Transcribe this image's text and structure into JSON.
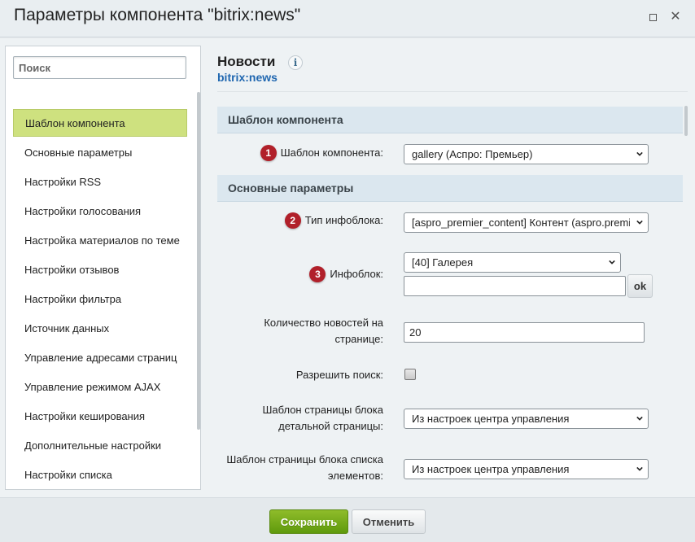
{
  "window": {
    "title": "Параметры компонента \"bitrix:news\"",
    "maximize_icon": "maximize-icon",
    "close_icon": "close-icon",
    "close_glyph": "✕"
  },
  "sidebar": {
    "search_placeholder": "Поиск",
    "items": [
      {
        "label": "Шаблон компонента",
        "active": true
      },
      {
        "label": "Основные параметры"
      },
      {
        "label": "Настройки RSS"
      },
      {
        "label": "Настройки голосования"
      },
      {
        "label": "Настройка материалов по теме"
      },
      {
        "label": "Настройки отзывов"
      },
      {
        "label": "Настройки фильтра"
      },
      {
        "label": "Источник данных"
      },
      {
        "label": "Управление адресами страниц"
      },
      {
        "label": "Управление режимом AJAX"
      },
      {
        "label": "Настройки кеширования"
      },
      {
        "label": "Дополнительные настройки"
      },
      {
        "label": "Настройки списка"
      }
    ]
  },
  "component": {
    "name": "Новости",
    "code": "bitrix:news",
    "info_glyph": "i"
  },
  "sections": {
    "template": "Шаблон компонента",
    "basic": "Основные параметры"
  },
  "fields": {
    "template": {
      "badge": "1",
      "label": "Шаблон компонента:",
      "value": "gallery (Аспро: Премьер)"
    },
    "iblock_type": {
      "badge": "2",
      "label": "Тип инфоблока:",
      "value": "[aspro_premier_content] Контент (aspro.premier)"
    },
    "iblock": {
      "badge": "3",
      "label": "Инфоблок:",
      "value": "[40] Галерея",
      "extra_value": "",
      "ok_label": "ok"
    },
    "news_count": {
      "label_line1": "Количество новостей на",
      "label_line2": "странице:",
      "value": "20"
    },
    "allow_search": {
      "label": "Разрешить поиск:",
      "checked": false
    },
    "detail_template": {
      "label_line1": "Шаблон страницы блока",
      "label_line2": "детальной страницы:",
      "value": "Из настроек центра управления"
    },
    "list_template": {
      "label_line1": "Шаблон страницы блока списка",
      "label_line2": "элементов:",
      "value": "Из настроек центра управления"
    }
  },
  "footer": {
    "save_label": "Сохранить",
    "cancel_label": "Отменить"
  },
  "colors": {
    "accent_green": "#6aa514",
    "active_item": "#cee17f",
    "badge_red": "#b1202a",
    "section_bg": "#dbe7ef",
    "link_blue": "#2067b0"
  }
}
